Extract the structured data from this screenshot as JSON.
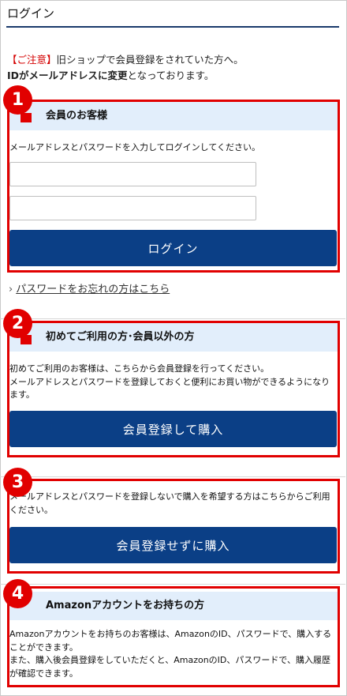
{
  "page": {
    "title": "ログイン"
  },
  "notice": {
    "warn": "【ご注意】",
    "line1": "旧ショップで会員登録をされていた方へ。",
    "line2_bold": "IDがメールアドレスに変更",
    "line2_rest": "となっております。"
  },
  "member": {
    "number": "1",
    "heading": "会員のお客様",
    "instruction": "メールアドレスとパスワードを入力してログインしてください。",
    "email_value": "",
    "password_value": "",
    "login_button": "ログイン"
  },
  "forgot": {
    "chevron": "›",
    "link": "パスワードをお忘れの方はこちら"
  },
  "first_time": {
    "number": "2",
    "heading": "初めてご利用の方･会員以外の方",
    "text1": "初めてご利用のお客様は、こちらから会員登録を行ってください。",
    "text2": "メールアドレスとパスワードを登録しておくと便利にお買い物ができるようになります。",
    "button": "会員登録して購入"
  },
  "guest": {
    "number": "3",
    "text": "メールアドレスとパスワードを登録しないで購入を希望する方はこちらからご利用ください。",
    "button": "会員登録せずに購入"
  },
  "amazon": {
    "number": "4",
    "heading": "Amazonアカウントをお持ちの方",
    "text1": "Amazonアカウントをお持ちのお客様は、AmazonのID、パスワードで、購入することができます。",
    "text2": "また、購入後会員登録をしていただくと、AmazonのID、パスワードで、購入履歴が確認できます。"
  },
  "colors": {
    "accent": "#0b3f86",
    "highlight": "#e10000",
    "header_bg": "#e2eefb"
  }
}
